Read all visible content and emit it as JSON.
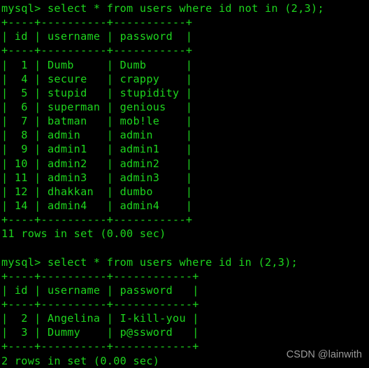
{
  "terminal": {
    "prompt": "mysql> ",
    "foreground_color": "#1ed61e",
    "background_color": "#000000",
    "blocks": [
      {
        "command": "mysql> select * from users where id not in (2,3);",
        "table": {
          "border": "+----+----------+-----------+",
          "header": "| id | username | password  |",
          "rows": [
            "|  1 | Dumb     | Dumb      |",
            "|  4 | secure   | crappy    |",
            "|  5 | stupid   | stupidity |",
            "|  6 | superman | genious   |",
            "|  7 | batman   | mob!le    |",
            "|  8 | admin    | admin     |",
            "|  9 | admin1   | admin1    |",
            "| 10 | admin2   | admin2    |",
            "| 11 | admin3   | admin3    |",
            "| 12 | dhakkan  | dumbo     |",
            "| 14 | admin4   | admin4    |"
          ]
        },
        "status": "11 rows in set (0.00 sec)"
      },
      {
        "command": "mysql> select * from users where id in (2,3);",
        "table": {
          "border": "+----+----------+------------+",
          "header": "| id | username | password   |",
          "rows": [
            "|  2 | Angelina | I-kill-you |",
            "|  3 | Dummy    | p@ssword   |"
          ]
        },
        "status": "2 rows in set (0.00 sec)"
      }
    ],
    "lines": [
      "mysql> select * from users where id not in (2,3);",
      "+----+----------+-----------+",
      "| id | username | password  |",
      "+----+----------+-----------+",
      "|  1 | Dumb     | Dumb      |",
      "|  4 | secure   | crappy    |",
      "|  5 | stupid   | stupidity |",
      "|  6 | superman | genious   |",
      "|  7 | batman   | mob!le    |",
      "|  8 | admin    | admin     |",
      "|  9 | admin1   | admin1    |",
      "| 10 | admin2   | admin2    |",
      "| 11 | admin3   | admin3    |",
      "| 12 | dhakkan  | dumbo     |",
      "| 14 | admin4   | admin4    |",
      "+----+----------+-----------+",
      "11 rows in set (0.00 sec)",
      "",
      "mysql> select * from users where id in (2,3);",
      "+----+----------+------------+",
      "| id | username | password   |",
      "+----+----------+------------+",
      "|  2 | Angelina | I-kill-you |",
      "|  3 | Dummy    | p@ssword   |",
      "+----+----------+------------+",
      "2 rows in set (0.00 sec)"
    ]
  },
  "watermark": {
    "text": "CSDN @lainwith"
  }
}
